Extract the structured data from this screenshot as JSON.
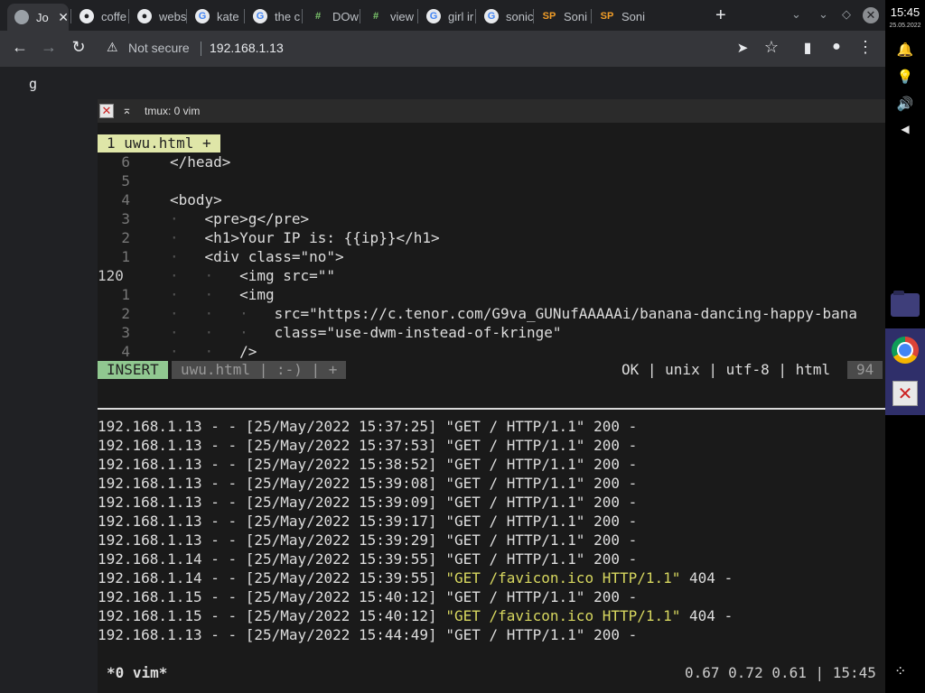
{
  "tabs": [
    {
      "title": "Jo",
      "favicon": "globe-icon",
      "active": true
    },
    {
      "title": "coffe",
      "favicon": "github-icon"
    },
    {
      "title": "webs",
      "favicon": "github-icon"
    },
    {
      "title": "kate",
      "favicon": "google-icon"
    },
    {
      "title": "the c",
      "favicon": "google-icon"
    },
    {
      "title": "DOw",
      "favicon": "green-logo-icon"
    },
    {
      "title": "view",
      "favicon": "green-logo-icon"
    },
    {
      "title": "girl ir",
      "favicon": "google-icon"
    },
    {
      "title": "sonic",
      "favicon": "google-icon"
    },
    {
      "title": "Soni",
      "favicon": "sp-icon",
      "favicon_text": "SP"
    },
    {
      "title": "Soni",
      "favicon": "sp-icon",
      "favicon_text": "SP"
    }
  ],
  "toolbar": {
    "security_text": "Not secure",
    "url": "192.168.1.13"
  },
  "page": {
    "pre_text": "g"
  },
  "system": {
    "time": "15:45",
    "date": "25.05.2022"
  },
  "terminal": {
    "title": "tmux: 0 vim",
    "buffer_tab": "1 uwu.html +",
    "code_lines": [
      {
        "num": "6",
        "indent": "",
        "text": "</head>"
      },
      {
        "num": "5",
        "indent": "",
        "text": ""
      },
      {
        "num": "4",
        "indent": "",
        "text": "<body>"
      },
      {
        "num": "3",
        "indent": "·   ",
        "text": "<pre>g</pre>"
      },
      {
        "num": "2",
        "indent": "·   ",
        "text": "<h1>Your IP is: {{ip}}</h1>"
      },
      {
        "num": "1",
        "indent": "·   ",
        "text": "<div class=\"no\">"
      },
      {
        "num": "120",
        "indent": "·   ·   ",
        "text": "<img src=\"\"",
        "current": true
      },
      {
        "num": "1",
        "indent": "·   ·   ",
        "text": "<img"
      },
      {
        "num": "2",
        "indent": "·   ·   ·   ",
        "text": "src=\"https://c.tenor.com/G9va_GUNufAAAAAi/banana-dancing-happy-bana"
      },
      {
        "num": "3",
        "indent": "·   ·   ·   ",
        "text": "class=\"use-dwm-instead-of-kringe\""
      },
      {
        "num": "4",
        "indent": "·   ·   ",
        "text": "/>"
      }
    ],
    "status": {
      "mode": "INSERT",
      "file_info": "uwu.html | :-) | +",
      "right": "OK | unix | utf-8 | html",
      "percent": "94"
    },
    "log_lines": [
      {
        "pre": "192.168.1.13 - - [25/May/2022 15:37:25] ",
        "req": "\"GET / HTTP/1.1\"",
        "post": " 200 -"
      },
      {
        "pre": "192.168.1.13 - - [25/May/2022 15:37:53] ",
        "req": "\"GET / HTTP/1.1\"",
        "post": " 200 -"
      },
      {
        "pre": "192.168.1.13 - - [25/May/2022 15:38:52] ",
        "req": "\"GET / HTTP/1.1\"",
        "post": " 200 -"
      },
      {
        "pre": "192.168.1.13 - - [25/May/2022 15:39:08] ",
        "req": "\"GET / HTTP/1.1\"",
        "post": " 200 -"
      },
      {
        "pre": "192.168.1.13 - - [25/May/2022 15:39:09] ",
        "req": "\"GET / HTTP/1.1\"",
        "post": " 200 -"
      },
      {
        "pre": "192.168.1.13 - - [25/May/2022 15:39:17] ",
        "req": "\"GET / HTTP/1.1\"",
        "post": " 200 -"
      },
      {
        "pre": "192.168.1.13 - - [25/May/2022 15:39:29] ",
        "req": "\"GET / HTTP/1.1\"",
        "post": " 200 -"
      },
      {
        "pre": "192.168.1.14 - - [25/May/2022 15:39:55] ",
        "req": "\"GET / HTTP/1.1\"",
        "post": " 200 -"
      },
      {
        "pre": "192.168.1.14 - - [25/May/2022 15:39:55] ",
        "req": "\"GET /favicon.ico HTTP/1.1\"",
        "post": " 404 -",
        "highlight": true
      },
      {
        "pre": "192.168.1.15 - - [25/May/2022 15:40:12] ",
        "req": "\"GET / HTTP/1.1\"",
        "post": " 200 -"
      },
      {
        "pre": "192.168.1.15 - - [25/May/2022 15:40:12] ",
        "req": "\"GET /favicon.ico HTTP/1.1\"",
        "post": " 404 -",
        "highlight": true
      },
      {
        "pre": "192.168.1.13 - - [25/May/2022 15:44:49] ",
        "req": "\"GET / HTTP/1.1\"",
        "post": " 200 -"
      }
    ],
    "tmux": {
      "left": "*0 vim*",
      "right": "0.67 0.72 0.61 | 15:45"
    }
  },
  "colors": {
    "vim_buffer_bg": "#dfe6a8",
    "vim_insert_bg": "#90c890",
    "log_highlight": "#d7d75f"
  }
}
